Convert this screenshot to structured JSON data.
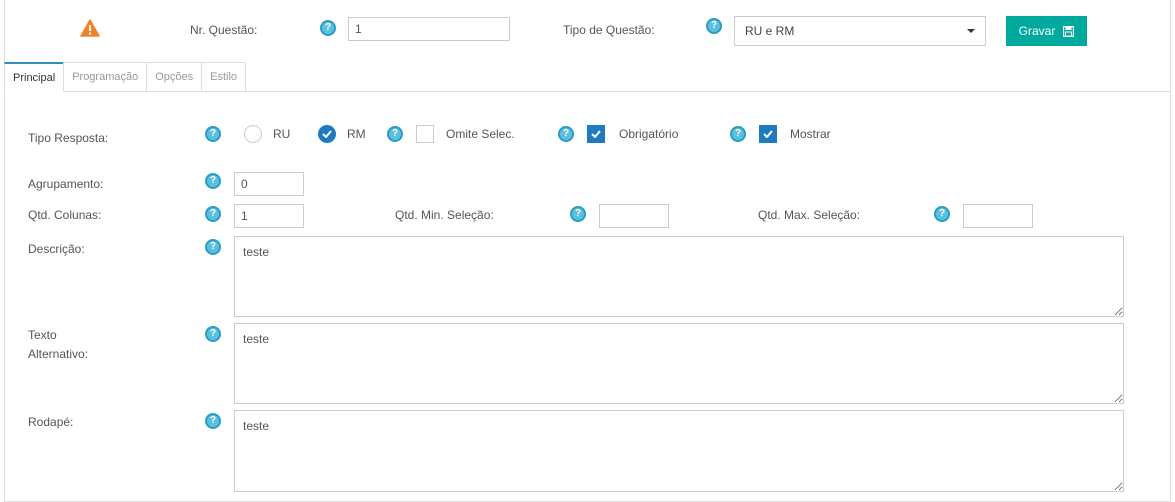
{
  "header": {
    "nr_questao_label": "Nr. Questão:",
    "nr_questao_value": "1",
    "tipo_questao_label": "Tipo de Questão:",
    "tipo_questao_value": "RU e RM",
    "save_label": "Gravar"
  },
  "tabs": [
    {
      "label": "Principal",
      "active": true
    },
    {
      "label": "Programação",
      "active": false
    },
    {
      "label": "Opções",
      "active": false
    },
    {
      "label": "Estilo",
      "active": false
    }
  ],
  "form": {
    "tipo_resposta_label": "Tipo Resposta:",
    "ru_label": "RU",
    "rm_label": "RM",
    "omite_label": "Omite Selec.",
    "obrigatorio_label": "Obrigatório",
    "mostrar_label": "Mostrar",
    "agrupamento_label": "Agrupamento:",
    "agrupamento_value": "0",
    "qtd_colunas_label": "Qtd. Colunas:",
    "qtd_colunas_value": "1",
    "qtd_min_label": "Qtd. Min. Seleção:",
    "qtd_min_value": "",
    "qtd_max_label": "Qtd. Max. Seleção:",
    "qtd_max_value": "",
    "descricao_label": "Descrição:",
    "descricao_value": "teste",
    "texto_alt_label_1": "Texto",
    "texto_alt_label_2": "Alternativo:",
    "texto_alt_value": "teste",
    "rodape_label": "Rodapé:",
    "rodape_value": "teste"
  },
  "state": {
    "ru_selected": false,
    "rm_selected": true,
    "omite_checked": false,
    "obrigatorio_checked": true,
    "mostrar_checked": true
  },
  "icons": {
    "warning": "warning-icon",
    "help": "help-icon",
    "save": "floppy-icon"
  },
  "colors": {
    "accent": "#00a99d",
    "primary": "#1f7bc1",
    "help": "#5bc0de",
    "warning": "#f0832a"
  }
}
